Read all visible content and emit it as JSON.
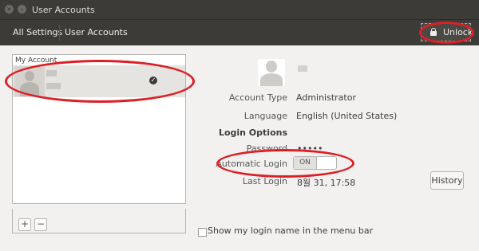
{
  "window": {
    "title": "User Accounts"
  },
  "toolbar": {
    "all_settings": "All Settings",
    "user_accounts": "User Accounts",
    "unlock_label": "Unlock"
  },
  "list": {
    "header": "My Account"
  },
  "details": {
    "account_type_label": "Account Type",
    "account_type_value": "Administrator",
    "language_label": "Language",
    "language_value": "English (United States)",
    "login_options_heading": "Login Options",
    "password_label": "Password",
    "password_value": "•••••",
    "auto_login_label": "Automatic Login",
    "auto_login_toggle": "ON",
    "last_login_label": "Last Login",
    "last_login_value": "8월 31, 17:58",
    "history_label": "History",
    "show_login_name_label": "Show my login name in the menu bar"
  },
  "list_footer": {
    "add_symbol": "+",
    "remove_symbol": "−"
  },
  "annotations": {
    "highlight_color": "#dd1f26"
  }
}
